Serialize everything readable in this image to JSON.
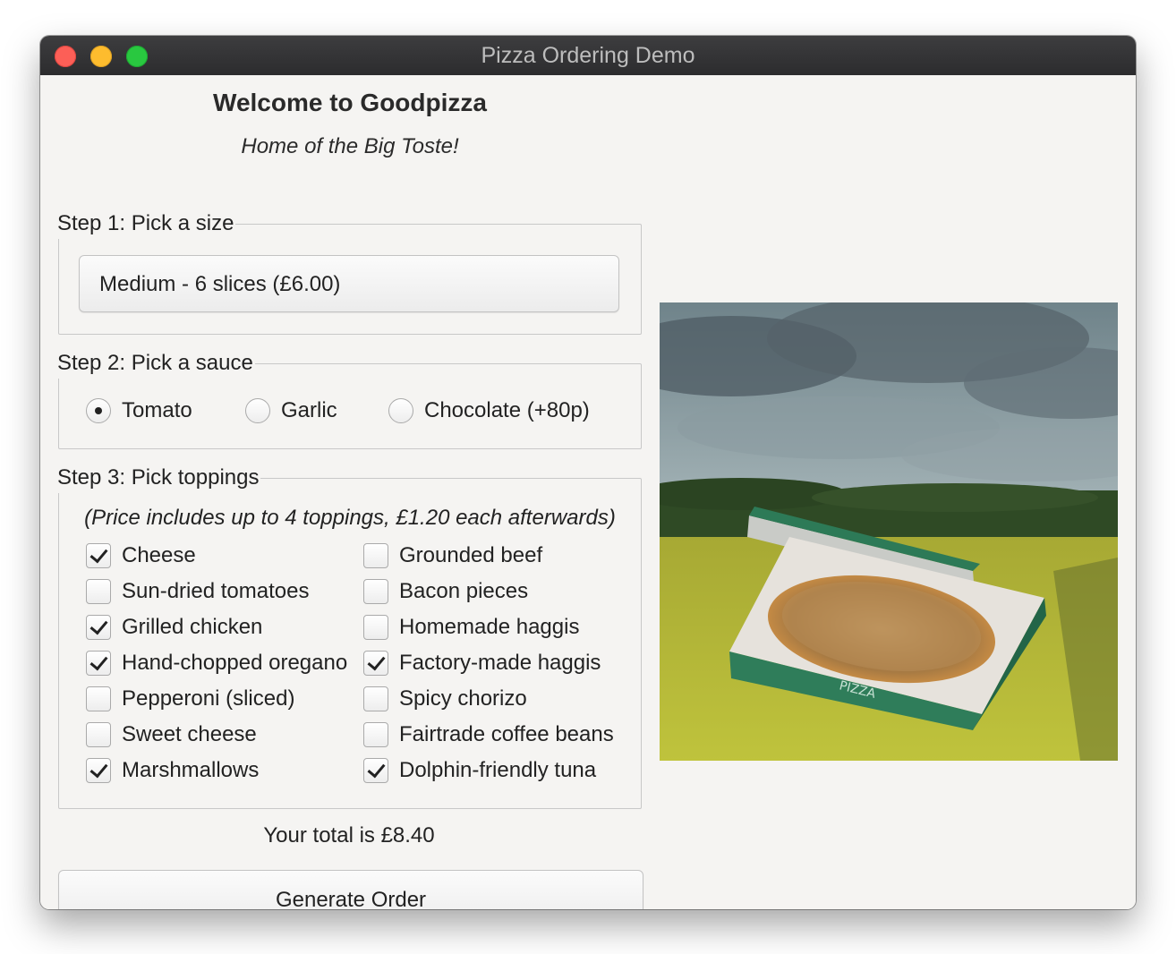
{
  "window": {
    "title": "Pizza Ordering Demo"
  },
  "header": {
    "welcome": "Welcome to Goodpizza",
    "tagline": "Home of the Big Toste!"
  },
  "step1": {
    "title": "Step 1: Pick a size",
    "selected": "Medium - 6 slices (£6.00)"
  },
  "step2": {
    "title": "Step 2: Pick a sauce",
    "options": [
      {
        "label": "Tomato",
        "selected": true
      },
      {
        "label": "Garlic",
        "selected": false
      },
      {
        "label": "Chocolate (+80p)",
        "selected": false
      }
    ]
  },
  "step3": {
    "title": "Step 3: Pick toppings",
    "note": "(Price includes up to 4 toppings, £1.20 each afterwards)",
    "toppings": [
      {
        "label": "Cheese",
        "checked": true
      },
      {
        "label": "Grounded beef",
        "checked": false
      },
      {
        "label": "Sun-dried tomatoes",
        "checked": false
      },
      {
        "label": "Bacon pieces",
        "checked": false
      },
      {
        "label": "Grilled chicken",
        "checked": true
      },
      {
        "label": "Homemade haggis",
        "checked": false
      },
      {
        "label": "Hand-chopped oregano",
        "checked": true
      },
      {
        "label": "Factory-made haggis",
        "checked": true
      },
      {
        "label": "Pepperoni (sliced)",
        "checked": false
      },
      {
        "label": "Spicy chorizo",
        "checked": false
      },
      {
        "label": "Sweet cheese",
        "checked": false
      },
      {
        "label": "Fairtrade coffee beans",
        "checked": false
      },
      {
        "label": "Marshmallows",
        "checked": true
      },
      {
        "label": "Dolphin-friendly tuna",
        "checked": true
      }
    ]
  },
  "total": "Your total is £8.40",
  "generate_button": "Generate Order",
  "image": {
    "box_text": "PIZZA"
  }
}
